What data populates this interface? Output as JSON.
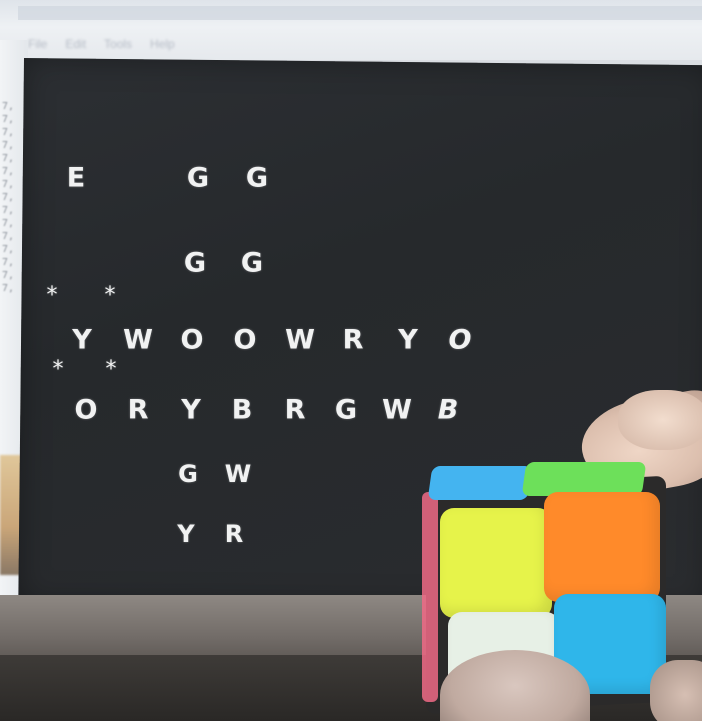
{
  "editor": {
    "menu": [
      "File",
      "Edit",
      "Tools",
      "Help"
    ]
  },
  "console": {
    "row1": [
      "E",
      "G",
      "G"
    ],
    "row2": [
      "G",
      "G"
    ],
    "stars_top": [
      "*",
      "*"
    ],
    "middle_row": [
      "Y",
      "W",
      "O",
      "O",
      "W",
      "R",
      "Y",
      "O"
    ],
    "stars_bottom": [
      "*",
      "*"
    ],
    "lower_row": [
      "O",
      "R",
      "Y",
      "B",
      "R",
      "G",
      "W",
      "B"
    ],
    "row7": [
      "G",
      "W"
    ],
    "row8": [
      "Y",
      "R"
    ]
  },
  "cube": {
    "colors": {
      "front_top_left": "#e6f34a",
      "front_top_right": "#ff8a2a",
      "front_bottom_left": "#e7f0e6",
      "front_bottom_right": "#2fb6ea",
      "top_left": "#44b4f0",
      "top_right": "#6de05a",
      "side": "#f06a86"
    }
  }
}
